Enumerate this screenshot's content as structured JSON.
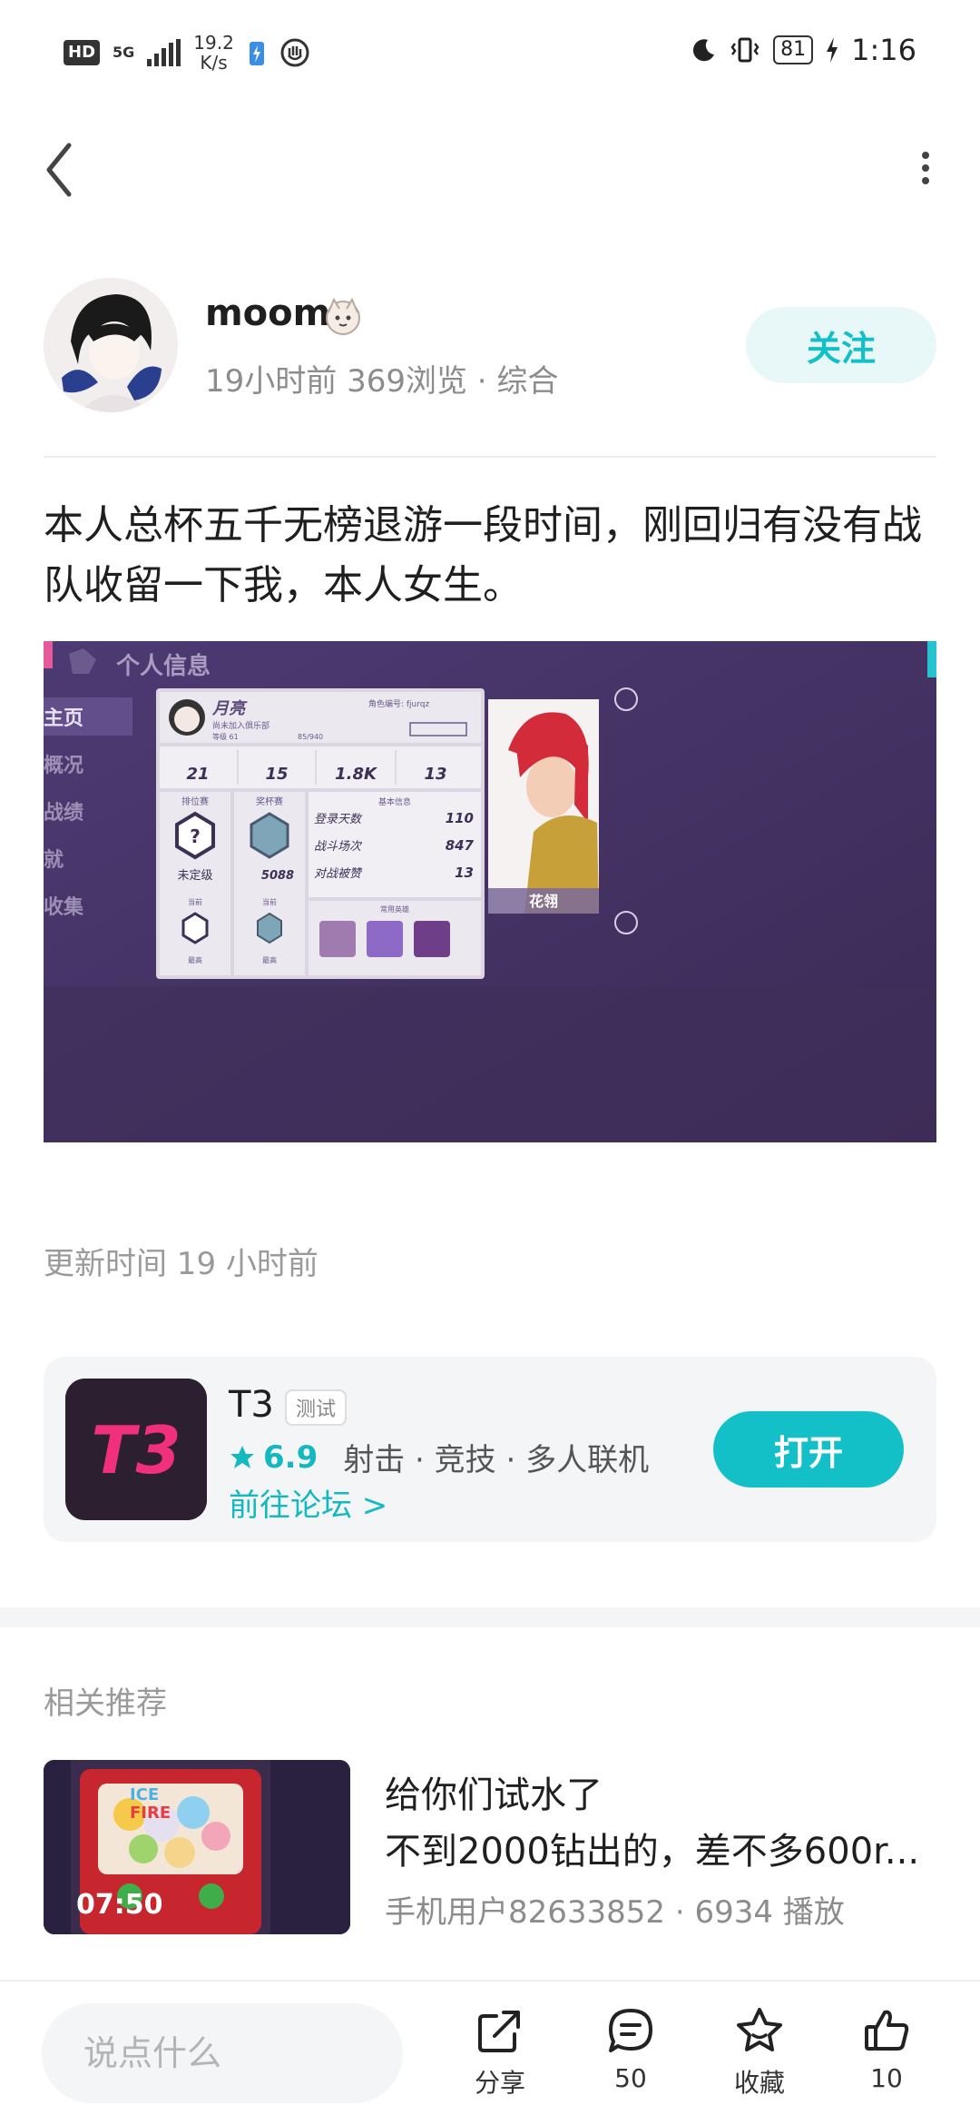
{
  "status_bar": {
    "hd": "HD",
    "network": "5G",
    "speed_value": "19.2",
    "speed_unit": "K/s",
    "battery": "81",
    "time": "1:16"
  },
  "author": {
    "name": "moom",
    "time_ago": "19小时前",
    "views": "369浏览",
    "category": "综合",
    "follow_label": "关注"
  },
  "post": {
    "text": "本人总杯五千无榜退游一段时间，刚回归有没有战队收留一下我，本人女生。",
    "update_time": "更新时间 19 小时前"
  },
  "game_screenshot": {
    "header": "个人信息",
    "player_name": "月亮",
    "club": "尚未加入俱乐部",
    "level": "等级 61",
    "exp": "85/940",
    "role_id": "角色编号: fjurqz",
    "side_menu": [
      "主页",
      "概况",
      "战绩",
      "就",
      "收集"
    ],
    "stats": [
      "21",
      "15",
      "1.8K",
      "13"
    ],
    "rank_label": "排位赛",
    "rank_value": "未定级",
    "cup_label": "奖杯赛",
    "cup_value": "5088",
    "current_label": "当前",
    "highest_label": "最高",
    "basic_info": "基本信息",
    "login_days_label": "登录天数",
    "login_days": "110",
    "battles_label": "战斗场次",
    "battles": "847",
    "likes_label": "对战被赞",
    "likes": "13",
    "heroes_label": "常用英雄",
    "hero_name": "花翎"
  },
  "app_card": {
    "name": "T3",
    "tag": "测试",
    "rating": "6.9",
    "genres": "射击 · 竞技 · 多人联机",
    "forum_link": "前往论坛 >",
    "open_label": "打开",
    "icon_text": "T3"
  },
  "related": {
    "title": "相关推荐",
    "duration": "07:50",
    "line1": "给你们试水了",
    "line2": "不到2000钻出的，差不多600r...",
    "meta": "手机用户82633852 · 6934 播放"
  },
  "bottom_bar": {
    "comment_placeholder": "说点什么",
    "share_label": "分享",
    "comment_count": "50",
    "collect_label": "收藏",
    "like_count": "10"
  },
  "colors": {
    "accent": "#14c0c8",
    "accent_light": "#e8f8f9",
    "text_primary": "#1f1f1f",
    "text_secondary": "#8c8c8c"
  }
}
